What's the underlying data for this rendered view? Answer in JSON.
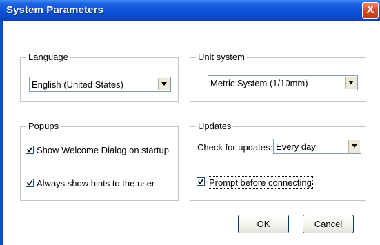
{
  "window": {
    "title": "System Parameters",
    "close_glyph": "X"
  },
  "language": {
    "legend": "Language",
    "selected": "English (United States)"
  },
  "unit_system": {
    "legend": "Unit system",
    "selected": "Metric System (1/10mm)"
  },
  "popups": {
    "legend": "Popups",
    "options": [
      {
        "label": "Show Welcome Dialog on startup",
        "checked": true
      },
      {
        "label": "Always show hints to the user",
        "checked": true
      }
    ]
  },
  "updates": {
    "legend": "Updates",
    "check_label": "Check for updates:",
    "frequency": "Every day",
    "prompt": {
      "label": "Prompt before connecting",
      "checked": true
    }
  },
  "buttons": {
    "ok": "OK",
    "cancel": "Cancel"
  },
  "icons": {
    "dropdown": "chevron-down-icon",
    "close": "close-icon",
    "check": "checkmark-icon"
  },
  "colors": {
    "titlebar": "#0b52d9",
    "close": "#d8512e",
    "frame": "#c7c4b8"
  }
}
